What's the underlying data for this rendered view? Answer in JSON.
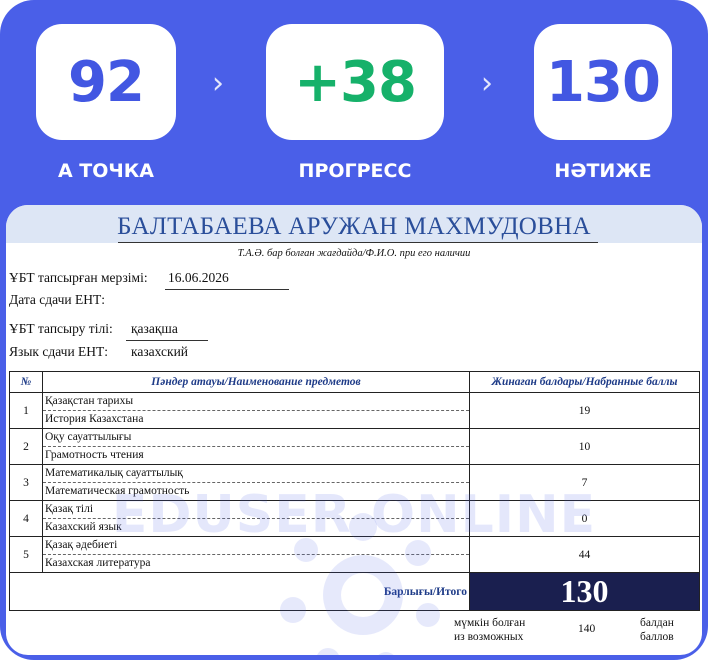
{
  "stats": {
    "a_value": "92",
    "a_label": "А ТОЧКА",
    "progress_value": "+38",
    "progress_label": "ПРОГРЕСС",
    "result_value": "130",
    "result_label": "НӘТИЖЕ",
    "chevron": "›"
  },
  "doc": {
    "full_name": "БАЛТАБАЕВА АРУЖАН МАХМУДОВНА",
    "fio_caption": "Т.А.Ә. бар болған жағдайда/Ф.И.О. при его наличии",
    "date_label_kz": "ҰБТ тапсырған мерзімі:",
    "date_value": "16.06.2026",
    "date_label_ru": "Дата сдачи ЕНТ:",
    "lang_label_kz": "ҰБТ тапсыру тілі:",
    "lang_value_kz": "қазақша",
    "lang_label_ru": "Язык сдачи ЕНТ:",
    "lang_value_ru": "казахский"
  },
  "table": {
    "headers": {
      "num": "№",
      "subject": "Пәндер атауы/Наименование предметов",
      "score": "Жинаған балдары/Набранные баллы"
    },
    "rows": [
      {
        "num": "1",
        "kz": "Қазақстан тарихы",
        "ru": "История Казахстана",
        "score": "19"
      },
      {
        "num": "2",
        "kz": "Оқу сауаттылығы",
        "ru": "Грамотность чтения",
        "score": "10"
      },
      {
        "num": "3",
        "kz": "Математикалық сауаттылық",
        "ru": "Математическая грамотность",
        "score": "7"
      },
      {
        "num": "4",
        "kz": "Қазақ тілі",
        "ru": "Казахский язык",
        "score": "0"
      },
      {
        "num": "5",
        "kz": "Қазақ әдебиеті",
        "ru": "Казахская литература",
        "score": "44"
      }
    ],
    "total_label": "Барлығы/Итого",
    "total_value": "130",
    "max_label_1": "мүмкін болған",
    "max_label_2": "из возможных",
    "max_value": "140",
    "unit_1": "балдан",
    "unit_2": "баллов"
  },
  "watermark": "EDUSER ONLINE",
  "colors": {
    "frame": "#4a5fe8",
    "accent_blue": "#4257e2",
    "progress_green": "#16b16a",
    "total_bg": "#1a1f4f"
  }
}
